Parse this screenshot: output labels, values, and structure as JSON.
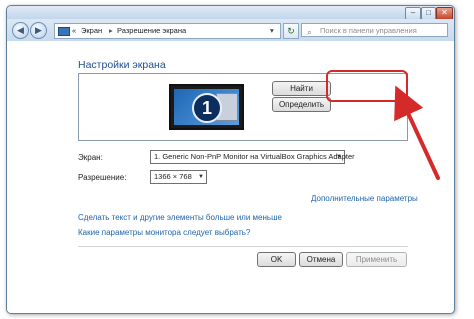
{
  "addressbar": {
    "sep1": "«",
    "crumb1": "Экран",
    "sep2": "▸",
    "crumb2": "Разрешение экрана",
    "dropdown": "▾"
  },
  "search": {
    "placeholder": "Поиск в панели управления"
  },
  "titlebar": {
    "minimize": "–",
    "maximize": "□",
    "close": "✕"
  },
  "content": {
    "heading": "Настройки экрана",
    "monitor_number": "1",
    "find_button": "Найти",
    "identify_button": "Определить",
    "screen_label": "Экран:",
    "screen_value": "1. Generic Non-PnP Monitor на VirtualBox Graphics Adapter",
    "resolution_label": "Разрешение:",
    "resolution_value": "1366 × 768",
    "advanced_link": "Дополнительные параметры",
    "link_text_size": "Сделать текст и другие элементы больше или меньше",
    "link_which_settings": "Какие параметры монитора следует выбрать?",
    "ok_button": "OK",
    "cancel_button": "Отмена",
    "apply_button": "Применить"
  },
  "icons": [
    "back-icon",
    "forward-icon",
    "monitor-icon",
    "refresh-icon",
    "search-icon",
    "dropdown-arrow-icon"
  ],
  "colors": {
    "heading": "#1e4f8c",
    "link": "#1e64ad",
    "highlight": "#d42a2a"
  }
}
